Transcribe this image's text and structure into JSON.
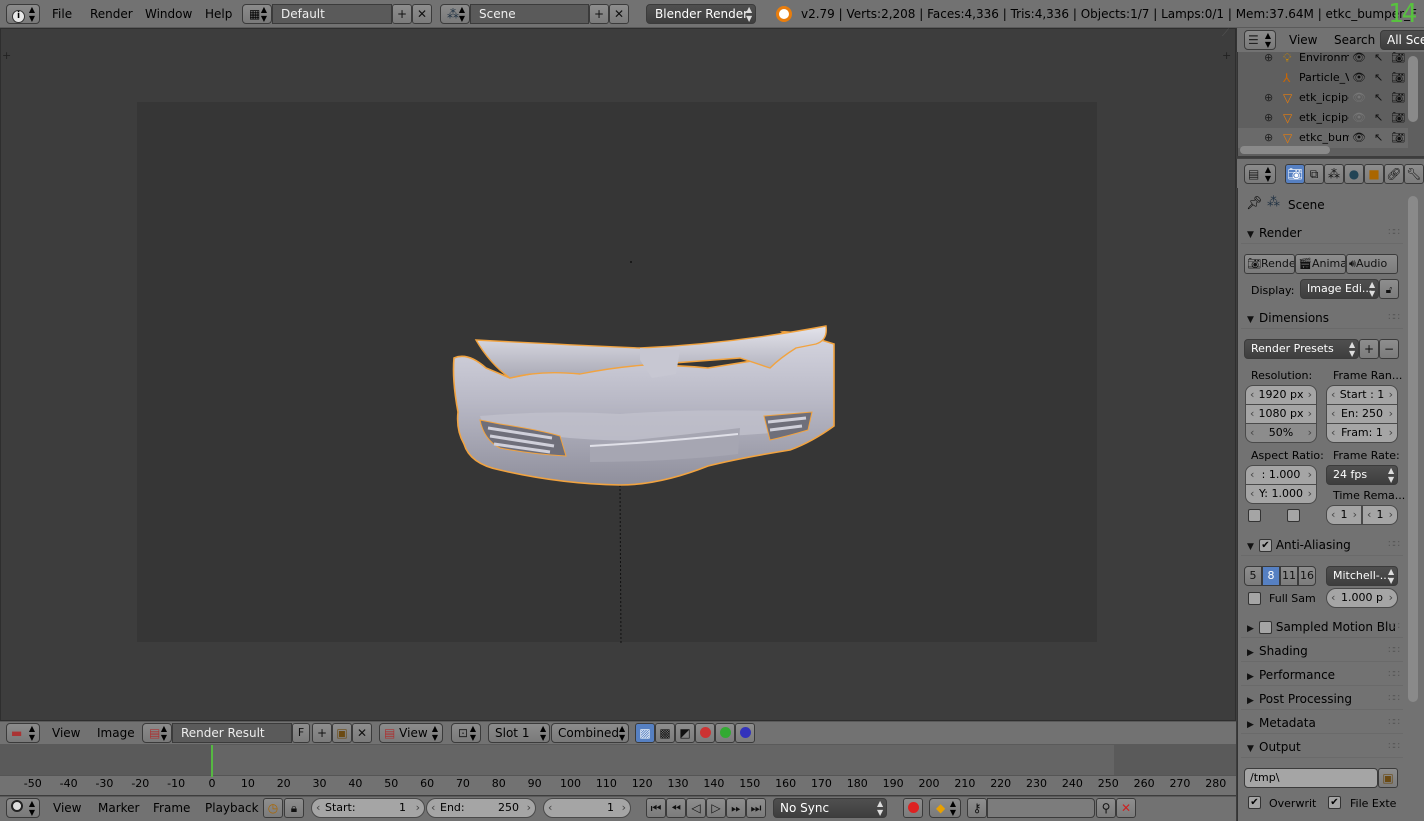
{
  "topbar": {
    "menus": [
      "File",
      "Render",
      "Window",
      "Help"
    ],
    "layout": "Default",
    "scene": "Scene",
    "engine": "Blender Render",
    "stats": "v2.79 | Verts:2,208 | Faces:4,336 | Tris:4,336 | Objects:1/7 | Lamps:0/1 | Mem:37.64M | etkc_bumper_F",
    "frame_badge": "14"
  },
  "outliner": {
    "menus": [
      "View",
      "Search"
    ],
    "filter": "All Sce",
    "items": [
      "Environm",
      "Particle_V",
      "etk_icpipe",
      "etk_icpipe",
      "etkc_bum"
    ]
  },
  "properties": {
    "context": "Scene",
    "render": {
      "title": "Render",
      "buttons": [
        "Rende",
        "Anima",
        "Audio"
      ],
      "display_label": "Display:",
      "display_value": "Image Edi..."
    },
    "dimensions": {
      "title": "Dimensions",
      "presets": "Render Presets",
      "resolution_label": "Resolution:",
      "res_x": "1920 px",
      "res_y": "1080 px",
      "res_pct": "50%",
      "frame_range_label": "Frame Ran...",
      "start": "Start : 1",
      "end": "En:  250",
      "frame": "Fram:  1",
      "aspect_label": "Aspect Ratio:",
      "aspect_x": ":  1.000",
      "aspect_y": "Y: 1.000",
      "frame_rate_label": "Frame Rate:",
      "fps": "24 fps",
      "time_label": "Time Rema...",
      "time_a": "1",
      "time_b": "1"
    },
    "aa": {
      "title": "Anti-Aliasing",
      "samples": [
        "5",
        "8",
        "11",
        "16"
      ],
      "selected": "8",
      "filter": "Mitchell-...",
      "full_sample": "Full Sam",
      "size": "1.000 p"
    },
    "collapsed": [
      "Sampled Motion Blu",
      "Shading",
      "Performance",
      "Post Processing",
      "Metadata"
    ],
    "output": {
      "title": "Output",
      "path": "/tmp\\",
      "overwrite": "Overwrit",
      "file_ext": "File Exte"
    }
  },
  "image_editor_header": {
    "menus": [
      "View",
      "Image"
    ],
    "image": "Render Result",
    "f_label": "F",
    "view": "View",
    "slot": "Slot 1",
    "pass": "Combined"
  },
  "timeline": {
    "ticks": [
      "-50",
      "-40",
      "-30",
      "-20",
      "-10",
      "0",
      "10",
      "20",
      "30",
      "40",
      "50",
      "60",
      "70",
      "80",
      "90",
      "100",
      "110",
      "120",
      "130",
      "140",
      "150",
      "160",
      "170",
      "180",
      "190",
      "200",
      "210",
      "220",
      "230",
      "240",
      "250",
      "260",
      "270",
      "280"
    ],
    "current_frame": 1,
    "menus": [
      "View",
      "Marker",
      "Frame",
      "Playback"
    ],
    "start": "Start:",
    "start_val": "1",
    "end": "End:",
    "end_val": "250",
    "current": "1",
    "sync": "No Sync"
  },
  "colors": {
    "accent_blue": "#5680c2",
    "selection_orange": "#f1a340",
    "frame_green": "#56b842"
  }
}
